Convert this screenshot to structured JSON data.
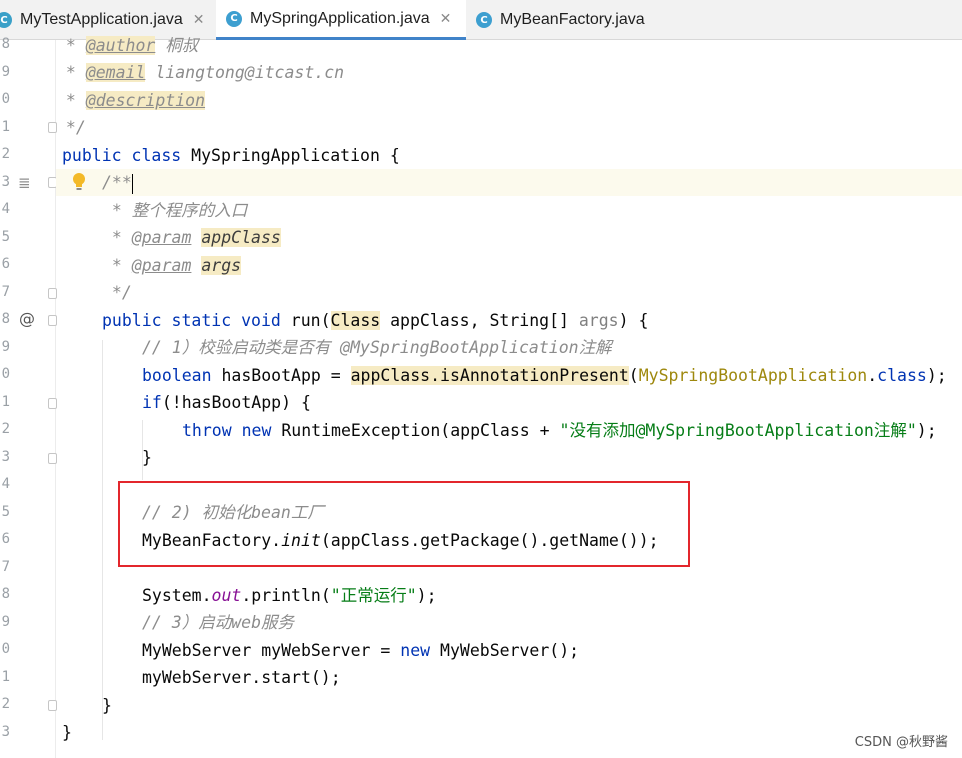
{
  "tabs": [
    {
      "label": "MyTestApplication.java",
      "icon": "java-run-class-icon",
      "active": false
    },
    {
      "label": "MySpringApplication.java",
      "icon": "java-class-icon",
      "active": true
    },
    {
      "label": "MyBeanFactory.java",
      "icon": "java-class-icon",
      "active": false
    }
  ],
  "tab_close_glyph": "✕",
  "line_numbers": [
    "8",
    "9",
    "0",
    "1",
    "2",
    "3",
    "4",
    "5",
    "6",
    "7",
    "8",
    "9",
    "0",
    "1",
    "2",
    "3",
    "4",
    "5",
    "6",
    "7",
    "8",
    "9",
    "0",
    "1",
    "2",
    "3"
  ],
  "code": {
    "l1_star": " * ",
    "l1_tag": "@author",
    "l1_text": " 桐叔",
    "l2_star": " * ",
    "l2_tag": "@email",
    "l2_text": " liangtong@itcast.cn",
    "l3_star": " * ",
    "l3_tag": "@description",
    "l4": " */",
    "l5_kw1": "public",
    "l5_kw2": "class",
    "l5_rest": " MySpringApplication {",
    "l6": "/**",
    "l7": " * 整个程序的入口",
    "l8_star": " * ",
    "l8_tag": "@param",
    "l8_name": "appClass",
    "l9_star": " * ",
    "l9_tag": "@param",
    "l9_name": "args",
    "l10": " */",
    "l11_kw1": "public",
    "l11_kw2": "static",
    "l11_kw3": "void",
    "l11_a": " run(",
    "l11_class": "Class",
    "l11_b": " appClass, String[] ",
    "l11_args": "args",
    "l11_c": ") {",
    "l12": "// 1）校验启动类是否有 @MySpringBootApplication注解",
    "l13_kw": "boolean",
    "l13_a": " hasBootApp = ",
    "l13_hl": "appClass.isAnnotationPresent",
    "l13_b": "(",
    "l13_ann": "MySpringBootApplication",
    "l13_c": ".",
    "l13_kw2": "class",
    "l13_d": ");",
    "l14_kw": "if",
    "l14_rest": "(!hasBootApp) {",
    "l15_kw1": "throw",
    "l15_kw2": "new",
    "l15_a": " RuntimeException(appClass + ",
    "l15_str": "\"没有添加@MySpringBootApplication注解\"",
    "l15_b": ");",
    "l16": "}",
    "l18": "// 2) 初始化bean工厂",
    "l19_a": "MyBeanFactory.",
    "l19_init": "init",
    "l19_b": "(appClass.getPackage().getName());",
    "l21_a": "System.",
    "l21_out": "out",
    "l21_b": ".println(",
    "l21_str": "\"正常运行\"",
    "l21_c": ");",
    "l22": "// 3）启动web服务",
    "l23_a": "MyWebServer myWebServer = ",
    "l23_kw": "new",
    "l23_b": " MyWebServer();",
    "l24": "myWebServer.start();",
    "l25": "}",
    "l26": "}"
  },
  "gutter": {
    "implement_marker": "@",
    "bookmark_marker": "≣"
  },
  "watermark": "CSDN @秋野酱",
  "colors": {
    "keyword": "#0033b3",
    "comment": "#8c8c8c",
    "annotation": "#9e880d",
    "string": "#067d17",
    "highlight": "#f6ebc4",
    "redbox": "#e3262c",
    "tab_underline": "#4083c9"
  }
}
